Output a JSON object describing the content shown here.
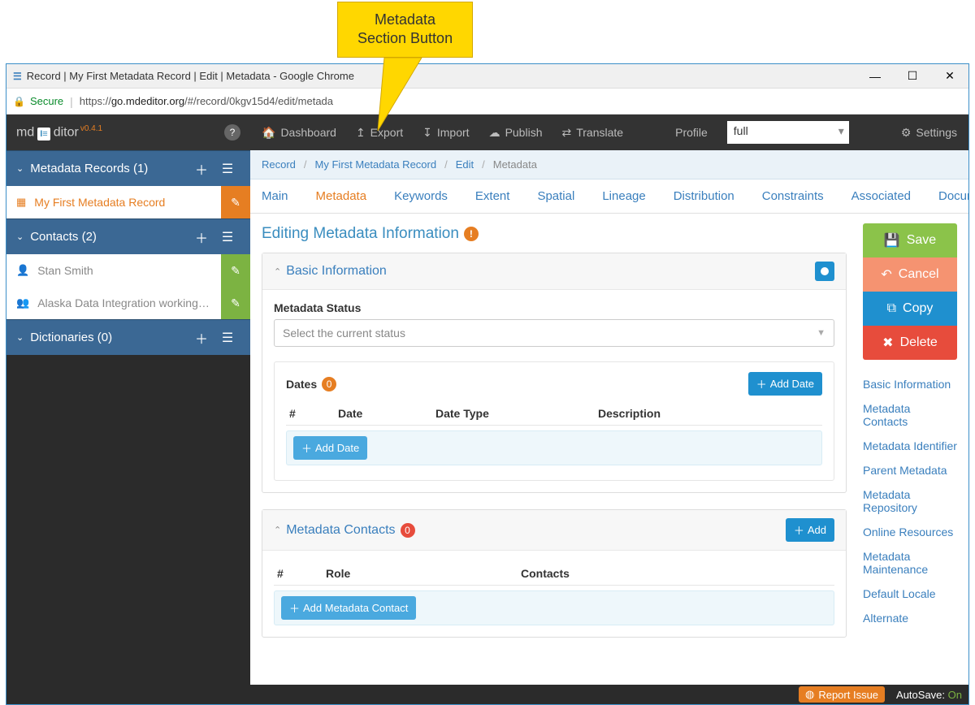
{
  "callout": {
    "text": "Metadata\nSection Button"
  },
  "chrome": {
    "title": "Record | My First Metadata Record | Edit | Metadata - Google Chrome",
    "secure": "Secure",
    "url_host": "go.mdeditor.org",
    "url_path": "/#/record/0kgv15d4/edit/metada",
    "url_prefix": "https://"
  },
  "brand": {
    "name_md": "md",
    "name_ditor": "ditor",
    "version": "v0.4.1"
  },
  "sidebar": {
    "sections": [
      {
        "label": "Metadata Records (1)"
      },
      {
        "label": "Contacts (2)"
      },
      {
        "label": "Dictionaries (0)"
      }
    ],
    "records": [
      {
        "label": "My First Metadata Record",
        "active": true
      }
    ],
    "contacts": [
      {
        "label": "Stan Smith"
      },
      {
        "label": "Alaska Data Integration working…"
      }
    ]
  },
  "topbar": {
    "items": [
      "Dashboard",
      "Export",
      "Import",
      "Publish",
      "Translate"
    ],
    "profile_label": "Profile",
    "profile_value": "full",
    "settings": "Settings"
  },
  "breadcrumbs": [
    "Record",
    "My First Metadata Record",
    "Edit",
    "Metadata"
  ],
  "tabs": [
    "Main",
    "Metadata",
    "Keywords",
    "Extent",
    "Spatial",
    "Lineage",
    "Distribution",
    "Constraints",
    "Associated",
    "Documents"
  ],
  "active_tab": "Metadata",
  "page_title": "Editing Metadata Information",
  "panels": {
    "basic": {
      "title": "Basic Information",
      "status_label": "Metadata Status",
      "status_placeholder": "Select the current status",
      "dates": {
        "title": "Dates",
        "count": "0",
        "add": "Add Date",
        "columns": [
          "#",
          "Date",
          "Date Type",
          "Description"
        ],
        "row_add": "Add Date"
      }
    },
    "contacts": {
      "title": "Metadata Contacts",
      "count": "0",
      "add": "Add",
      "columns": [
        "#",
        "Role",
        "Contacts"
      ],
      "row_add": "Add Metadata Contact"
    }
  },
  "actions": {
    "save": "Save",
    "cancel": "Cancel",
    "copy": "Copy",
    "delete": "Delete"
  },
  "anchors": [
    "Basic Information",
    "Metadata Contacts",
    "Metadata Identifier",
    "Parent Metadata",
    "Metadata Repository",
    "Online Resources",
    "Metadata Maintenance",
    "Default Locale",
    "Alternate"
  ],
  "statusbar": {
    "report": "Report Issue",
    "autosave_label": "AutoSave:",
    "autosave_value": "On"
  }
}
